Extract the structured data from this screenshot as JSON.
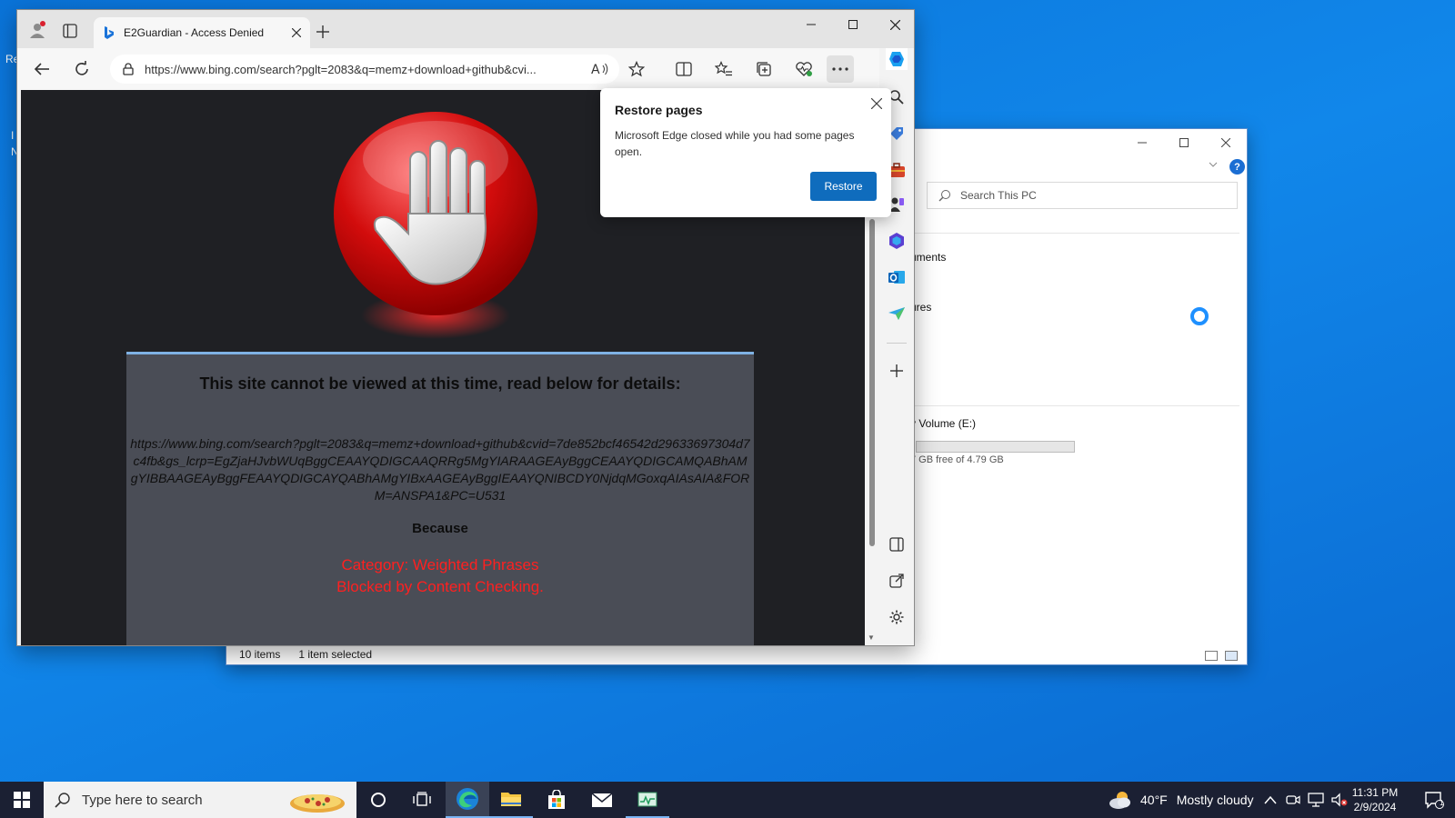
{
  "desktop": {
    "fragments": [
      "Re",
      "I",
      "N"
    ]
  },
  "explorer": {
    "search_placeholder": "Search This PC",
    "help_label": "?",
    "items": [
      "uments",
      "ures"
    ],
    "drive_name": "v Volume (E:)",
    "drive_free": "7 GB free of 4.79 GB",
    "status_items": "10 items",
    "status_selected": "1 item selected"
  },
  "edge": {
    "tab_title": "E2Guardian - Access Denied",
    "url": "https://www.bing.com/search?pglt=2083&q=memz+download+github&cvi...",
    "page": {
      "heading": "This site cannot be viewed at this time, read below for details:",
      "blocked_url": "https://www.bing.com/search?pglt=2083&q=memz+download+github&cvid=7de852bcf46542d29633697304d7c4fb&gs_lcrp=EgZjaHJvbWUqBggCEAAYQDIGCAAQRRg5MgYIARAAGEAyBggCEAAYQDIGCAMQABhAMgYIBBAAGEAyBggFEAAYQDIGCAYQABhAMgYIBxAAGEAyBggIEAAYQNIBCDY0NjdqMGoxqAIAsAIA&FORM=ANSPA1&PC=U531",
      "because": "Because",
      "category": "Category: Weighted Phrases",
      "blocked_by": "Blocked by Content Checking."
    },
    "popup": {
      "title": "Restore pages",
      "body": "Microsoft Edge closed while you had some pages open.",
      "button": "Restore"
    }
  },
  "taskbar": {
    "search_placeholder": "Type here to search",
    "weather_temp": "40°F",
    "weather_desc": "Mostly cloudy",
    "time": "11:31 PM",
    "date": "2/9/2024",
    "notification_count": "1"
  }
}
